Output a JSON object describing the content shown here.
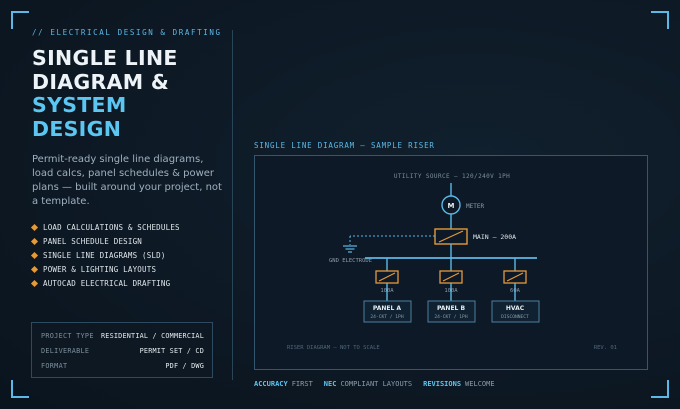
{
  "eyebrow": "// ELECTRICAL DESIGN & DRAFTING",
  "title": {
    "line1": "SINGLE LINE",
    "line2": "DIAGRAM &",
    "line3": "SYSTEM",
    "line4": "DESIGN"
  },
  "description": "Permit-ready single line diagrams, load calcs, panel schedules & power plans — built around your project, not a template.",
  "features": [
    "LOAD CALCULATIONS & SCHEDULES",
    "PANEL SCHEDULE DESIGN",
    "SINGLE LINE DIAGRAMS (SLD)",
    "POWER & LIGHTING LAYOUTS",
    "AUTOCAD ELECTRICAL DRAFTING"
  ],
  "info": [
    {
      "key": "PROJECT TYPE",
      "value": "RESIDENTIAL / COMMERCIAL"
    },
    {
      "key": "DELIVERABLE",
      "value": "PERMIT SET / CD"
    },
    {
      "key": "FORMAT",
      "value": "PDF / DWG"
    }
  ],
  "diagram": {
    "title": "SINGLE LINE DIAGRAM — SAMPLE RISER",
    "utility": "UTILITY SOURCE — 120/240V 1PH",
    "meter_symbol": "M",
    "meter_label": "METER",
    "main_label": "MAIN — 200A",
    "ground_label": "GND ELECTRODE",
    "breakers": [
      "100A",
      "100A",
      "60A"
    ],
    "panels": [
      {
        "name": "PANEL A",
        "sub": "24-CKT / 1PH"
      },
      {
        "name": "PANEL B",
        "sub": "24-CKT / 1PH"
      },
      {
        "name": "HVAC",
        "sub": "DISCONNECT"
      }
    ],
    "note": "RISER DIAGRAM — NOT TO SCALE",
    "revision": "REV. 01"
  },
  "footer": [
    {
      "strong": "ACCURACY",
      "plain": "FIRST"
    },
    {
      "strong": "NEC",
      "plain": "COMPLIANT LAYOUTS"
    },
    {
      "strong": "REVISIONS",
      "plain": "WELCOME"
    }
  ],
  "colors": {
    "accent": "#5cc6f2",
    "orange": "#e39a3b",
    "background": "#0e1a26"
  }
}
